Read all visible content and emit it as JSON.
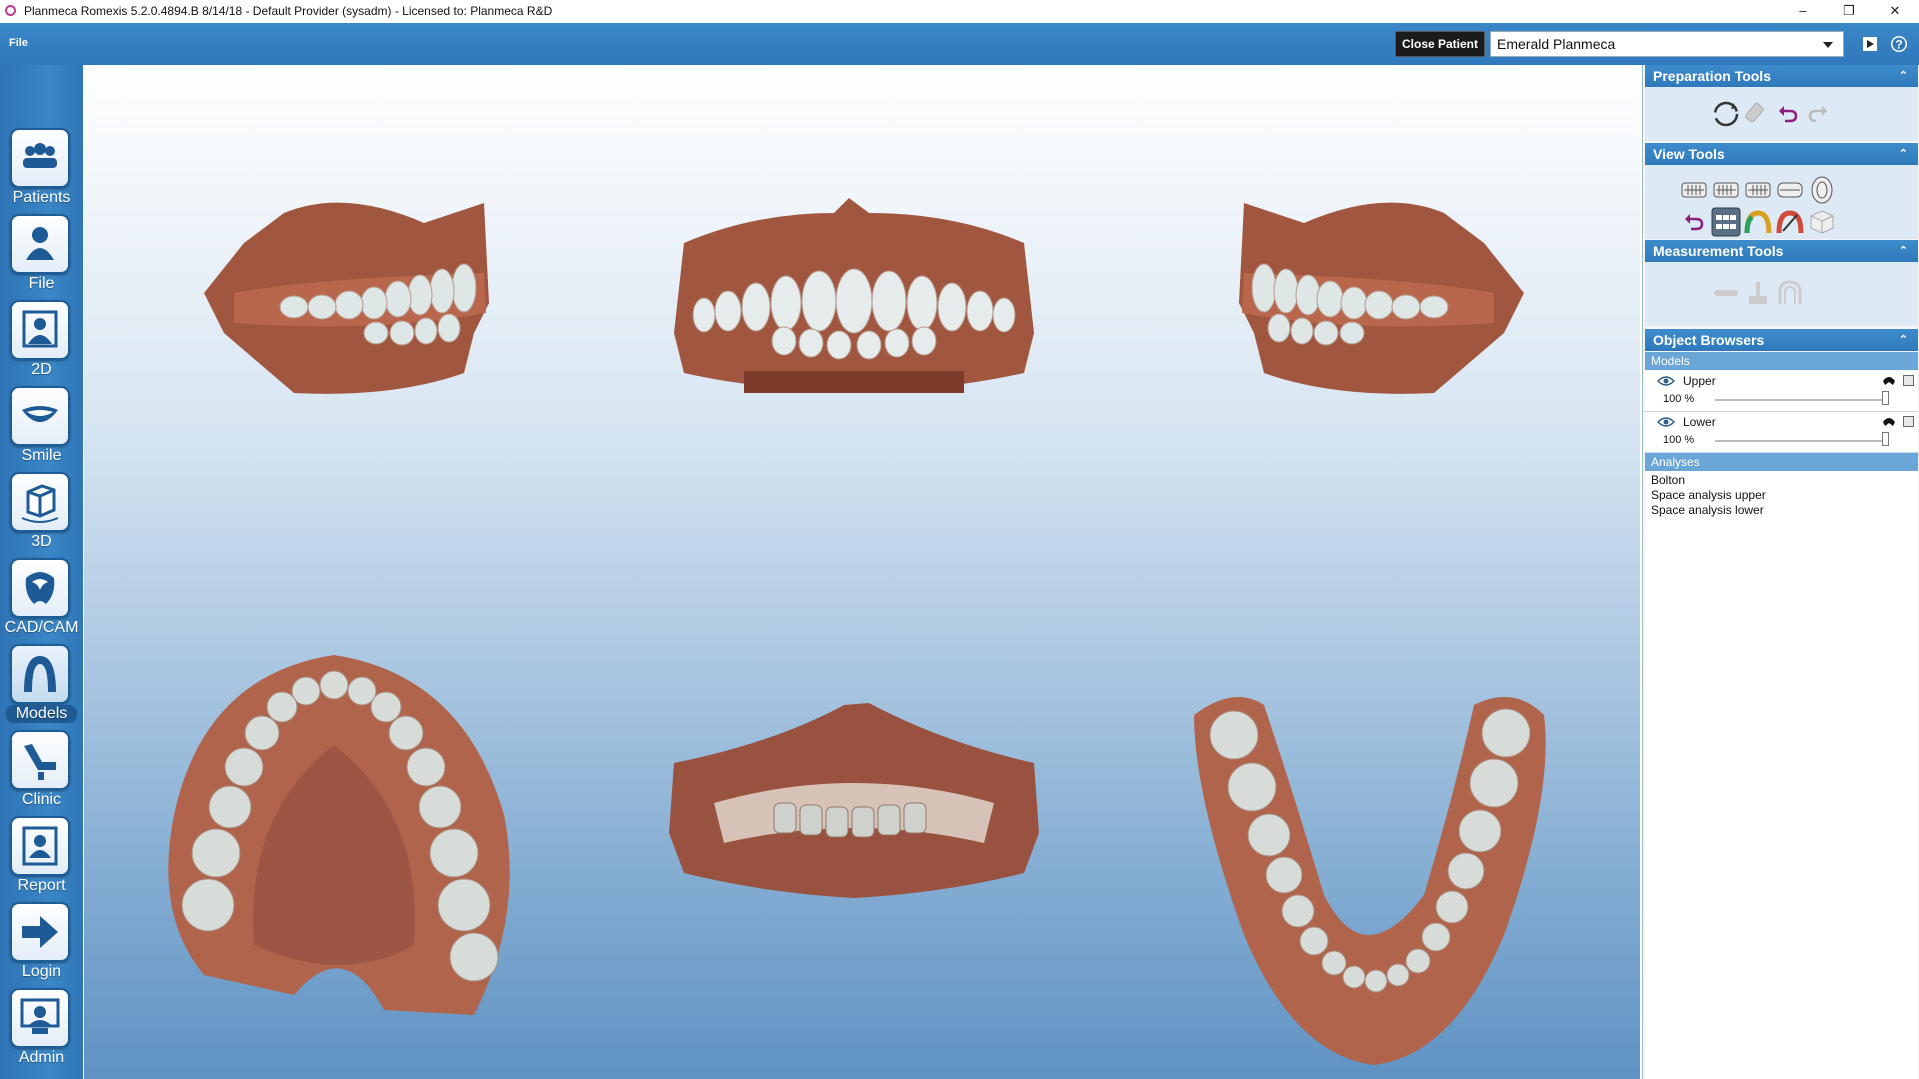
{
  "window": {
    "title": "Planmeca Romexis 5.2.0.4894.B  8/14/18 - Default Provider (sysadm) - Licensed to: Planmeca R&D",
    "controls": {
      "minimize": "–",
      "restore": "❐",
      "close": "✕"
    }
  },
  "menubar": {
    "file_label": "File",
    "close_patient_label": "Close Patient",
    "patient_name": "Emerald Planmeca"
  },
  "sidebar": {
    "items": [
      {
        "label": "Patients",
        "icon": "patients-icon"
      },
      {
        "label": "File",
        "icon": "file-icon"
      },
      {
        "label": "2D",
        "icon": "2d-icon"
      },
      {
        "label": "Smile",
        "icon": "smile-icon"
      },
      {
        "label": "3D",
        "icon": "3d-icon"
      },
      {
        "label": "CAD/CAM",
        "icon": "cadcam-icon"
      },
      {
        "label": "Models",
        "icon": "models-icon",
        "active": true
      },
      {
        "label": "Clinic",
        "icon": "clinic-icon"
      },
      {
        "label": "Report",
        "icon": "report-icon"
      },
      {
        "label": "Login",
        "icon": "login-icon"
      },
      {
        "label": "Admin",
        "icon": "admin-icon"
      }
    ]
  },
  "panel": {
    "preparation": {
      "title": "Preparation Tools",
      "collapse": "⌃"
    },
    "view": {
      "title": "View Tools",
      "collapse": "⌃"
    },
    "measurement": {
      "title": "Measurement Tools",
      "collapse": "⌃"
    },
    "objects": {
      "title": "Object Browsers",
      "collapse": "⌃"
    },
    "models_header": "Models",
    "models": [
      {
        "name": "Upper",
        "opacity": "100 %",
        "opacity_value": 100
      },
      {
        "name": "Lower",
        "opacity": "100 %",
        "opacity_value": 100
      }
    ],
    "analyses_header": "Analyses",
    "analyses": [
      "Bolton",
      "Space analysis upper",
      "Space analysis lower"
    ]
  },
  "colors": {
    "accent": "#2f79bb",
    "gum": "#b5604a",
    "tooth": "#e8ecec"
  }
}
